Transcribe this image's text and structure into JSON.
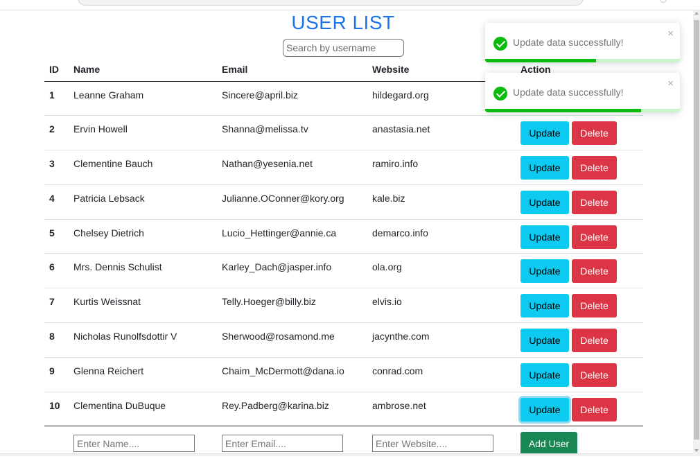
{
  "page": {
    "title": "USER LIST"
  },
  "search": {
    "placeholder": "Search by username"
  },
  "table": {
    "headers": {
      "id": "ID",
      "name": "Name",
      "email": "Email",
      "website": "Website",
      "action": "Action"
    },
    "rows": [
      {
        "id": "1",
        "name": "Leanne Graham",
        "email": "Sincere@april.biz",
        "website": "hildegard.org"
      },
      {
        "id": "2",
        "name": "Ervin Howell",
        "email": "Shanna@melissa.tv",
        "website": "anastasia.net"
      },
      {
        "id": "3",
        "name": "Clementine Bauch",
        "email": "Nathan@yesenia.net",
        "website": "ramiro.info"
      },
      {
        "id": "4",
        "name": "Patricia Lebsack",
        "email": "Julianne.OConner@kory.org",
        "website": "kale.biz"
      },
      {
        "id": "5",
        "name": "Chelsey Dietrich",
        "email": "Lucio_Hettinger@annie.ca",
        "website": "demarco.info"
      },
      {
        "id": "6",
        "name": "Mrs. Dennis Schulist",
        "email": "Karley_Dach@jasper.info",
        "website": "ola.org"
      },
      {
        "id": "7",
        "name": "Kurtis Weissnat",
        "email": "Telly.Hoeger@billy.biz",
        "website": "elvis.io"
      },
      {
        "id": "8",
        "name": "Nicholas Runolfsdottir V",
        "email": "Sherwood@rosamond.me",
        "website": "jacynthe.com"
      },
      {
        "id": "9",
        "name": "Glenna Reichert",
        "email": "Chaim_McDermott@dana.io",
        "website": "conrad.com"
      },
      {
        "id": "10",
        "name": "Clementina DuBuque",
        "email": "Rey.Padberg@karina.biz",
        "website": "ambrose.net"
      }
    ],
    "update_label": "Update",
    "delete_label": "Delete"
  },
  "form": {
    "name_placeholder": "Enter Name....",
    "email_placeholder": "Enter Email....",
    "website_placeholder": "Enter Website....",
    "add_label": "Add User"
  },
  "toasts": [
    {
      "message": "Update data successfully!",
      "close": "×",
      "icon": "check-circle-icon",
      "progress": 0.57
    },
    {
      "message": "Update data successfully!",
      "close": "×",
      "icon": "check-circle-icon",
      "progress": 0.8
    }
  ],
  "colors": {
    "title": "#1a73e8",
    "update": "#0dcaf0",
    "delete": "#dc3545",
    "add": "#198754",
    "toast_success": "#07bc0c"
  }
}
